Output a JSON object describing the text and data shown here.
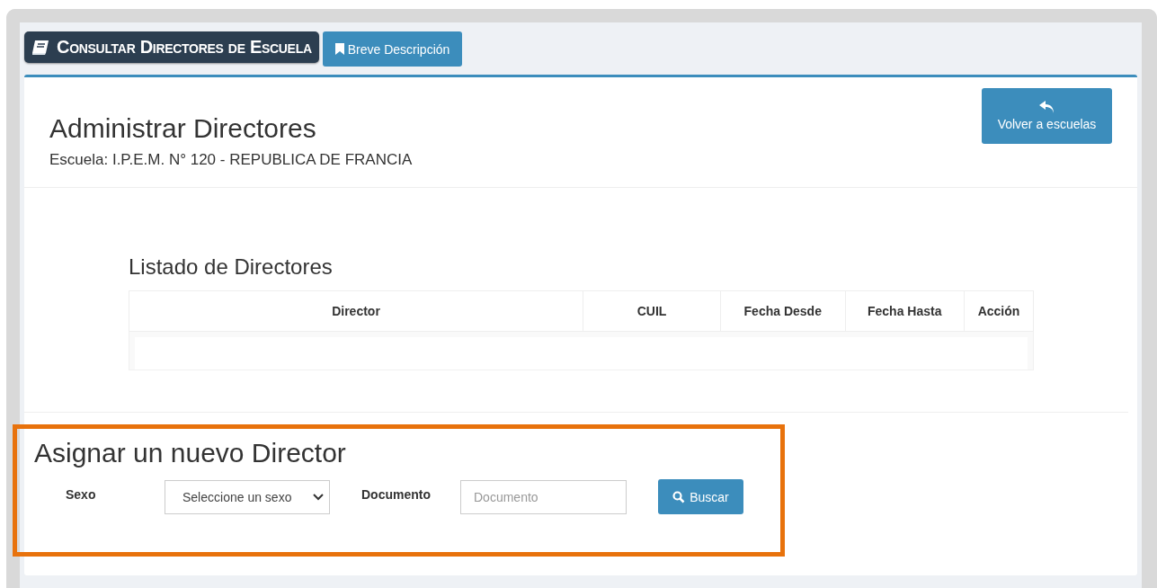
{
  "header": {
    "title": "Consultar Directores de Escuela",
    "description_button": "Breve Descripción"
  },
  "page": {
    "title": "Administrar Directores",
    "subtitle": "Escuela: I.P.E.M. N° 120 - REPUBLICA DE FRANCIA",
    "back_button": "Volver a escuelas"
  },
  "table": {
    "title": "Listado de Directores",
    "columns": [
      "Director",
      "CUIL",
      "Fecha Desde",
      "Fecha Hasta",
      "Acción"
    ]
  },
  "assign_form": {
    "title": "Asignar un nuevo Director",
    "highlighted": true,
    "sex_label": "Sexo",
    "sex_select": "Seleccione un sexo",
    "document_label": "Documento",
    "document_placeholder": "Documento",
    "search_button": "Buscar"
  }
}
